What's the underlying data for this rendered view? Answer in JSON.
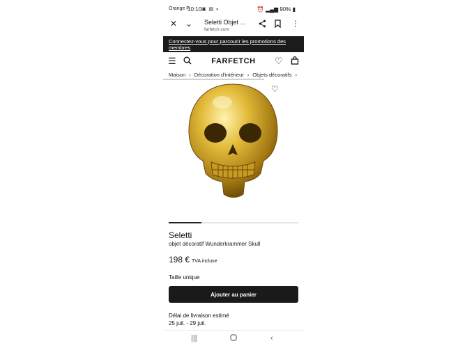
{
  "status_bar": {
    "carrier": "Orange F",
    "time": "10:10",
    "battery": "90%"
  },
  "browser": {
    "page_title": "Seletti Objet ...",
    "url": "farfetch.com"
  },
  "promo_banner": {
    "text": "Connectez-vous pour parcourir les promotions des membres"
  },
  "header": {
    "logo": "FARFETCH"
  },
  "breadcrumb": [
    "Maison",
    "Décoration d'intérieur",
    "Objets décoratifs"
  ],
  "product": {
    "brand": "Seletti",
    "name": "objet décoratif Wunderkrammer Skull",
    "price": "198 €",
    "tax_note": "TVA incluse",
    "size": "Taille unique",
    "add_to_cart_label": "Ajouter au panier",
    "delivery_label": "Délai de livraison estimé",
    "delivery_dates": "25 juil. - 29 juil.",
    "image_color": "#d4a62a"
  },
  "carousel": {
    "current_slide_fraction": 0.25
  }
}
